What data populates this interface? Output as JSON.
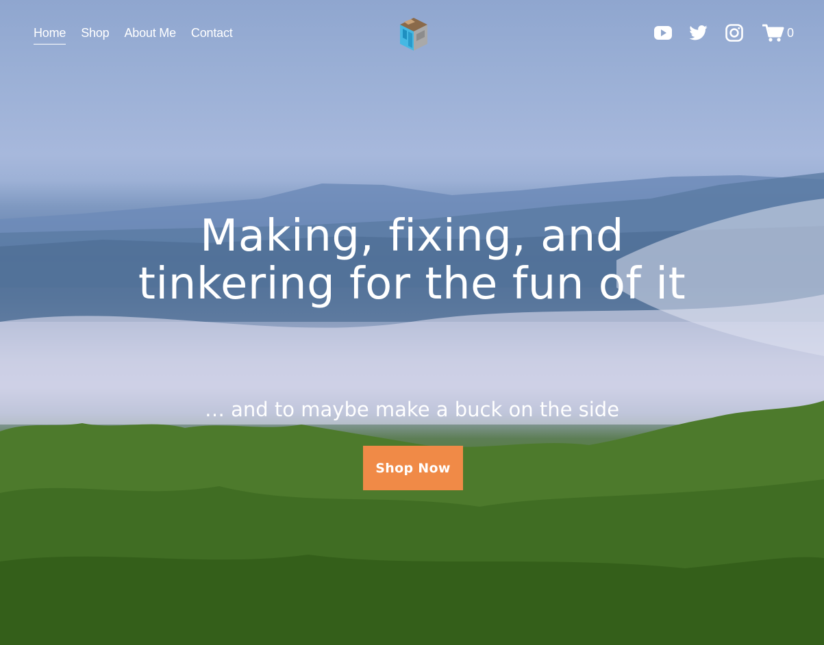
{
  "nav": {
    "items": [
      {
        "label": "Home",
        "active": true
      },
      {
        "label": "Shop",
        "active": false
      },
      {
        "label": "About Me",
        "active": false
      },
      {
        "label": "Contact",
        "active": false
      }
    ]
  },
  "header": {
    "social_icons": [
      "youtube-icon",
      "twitter-icon",
      "instagram-icon"
    ],
    "cart_count": "0"
  },
  "hero": {
    "title_line1": "Making, fixing, and",
    "title_line2": "tinkering for the fun of it",
    "subtitle": "… and to maybe make a buck on the side",
    "cta_label": "Shop Now"
  },
  "colors": {
    "cta": "#f08a47",
    "text": "#ffffff"
  }
}
